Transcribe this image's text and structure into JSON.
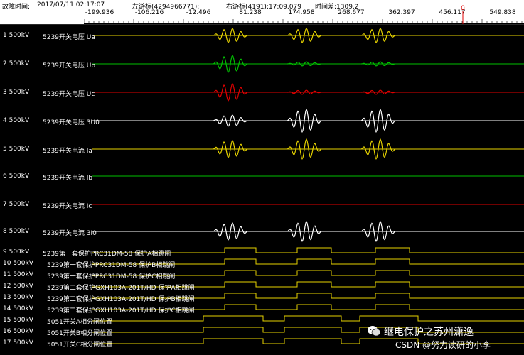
{
  "header": {
    "fault_time_label": "故障时间:",
    "fault_time_value": "2017/07/11 02:17:07",
    "left_cursor": "左游标(4294966771):",
    "right_cursor": "右游标(4191):17:09.079",
    "time_diff": "时间差:1309.2",
    "ticks": [
      "-199.936",
      "-106.216",
      "-12.496",
      "81.238",
      "174.958",
      "268.677",
      "362.397",
      "456.117",
      "549.838"
    ],
    "cursor_marker": "0"
  },
  "channels": [
    {
      "idx": "1 500kV",
      "name": "5239开关电压 Ua",
      "color": "#e6d200"
    },
    {
      "idx": "2 500kV",
      "name": "5239开关电压 Ub",
      "color": "#00c000"
    },
    {
      "idx": "3 500kV",
      "name": "5239开关电压 Uc",
      "color": "#e00000"
    },
    {
      "idx": "4 500kV",
      "name": "5239开关电压 3U0",
      "color": "#ffffff"
    },
    {
      "idx": "5 500kV",
      "name": "5239开关电流 Ia",
      "color": "#e6d200"
    },
    {
      "idx": "6 500kV",
      "name": "5239开关电流 Ib",
      "color": "#00c000"
    },
    {
      "idx": "7 500kV",
      "name": "5239开关电流 Ic",
      "color": "#e00000"
    },
    {
      "idx": "8 500kV",
      "name": "5239开关电流 3I0",
      "color": "#ffffff"
    }
  ],
  "digital": [
    {
      "idx": "9 500kV",
      "name": "5239第一套保护PRC31DM-58 保护A相跳闸"
    },
    {
      "idx": "10 500kV",
      "name": "5239第一套保护PRC31DM-58 保护B相跳闸"
    },
    {
      "idx": "11 500kV",
      "name": "5239第一套保护PRC31DM-58 保护C相跳闸"
    },
    {
      "idx": "12 500kV",
      "name": "5239第二套保护GXH103A-201T/HD 保护A相跳闸"
    },
    {
      "idx": "13 500kV",
      "name": "5239第二套保护GXH103A-201T/HD 保护B相跳闸"
    },
    {
      "idx": "14 500kV",
      "name": "5239第二套保护GXH103A-201T/HD 保护C相跳闸"
    },
    {
      "idx": "15 500kV",
      "name": "5051开关A相分闸位置"
    },
    {
      "idx": "16 500kV",
      "name": "5051开关B相分闸位置"
    },
    {
      "idx": "17 500kV",
      "name": "5051开关C相分闸位置"
    }
  ],
  "watermark": {
    "line1": "继电保护之苏州潇逸",
    "line2": "CSDN @努力读研的小李"
  }
}
